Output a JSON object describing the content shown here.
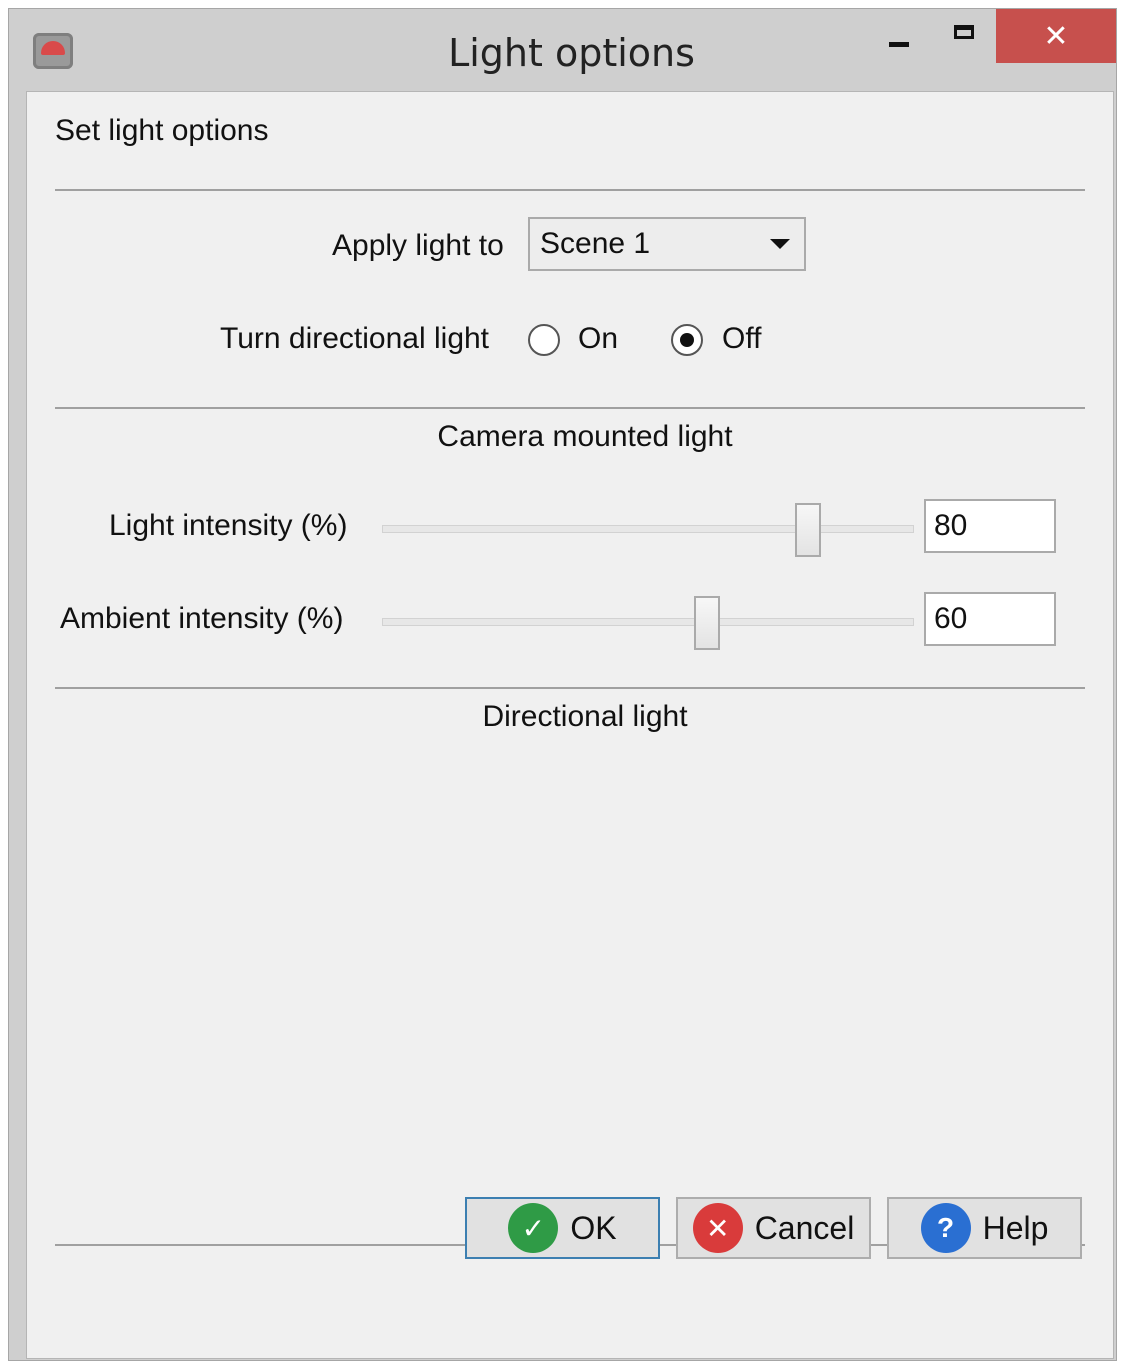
{
  "window": {
    "title": "Light options",
    "icon": "app-icon",
    "controls": {
      "minimize": "minimize-icon",
      "maximize": "maximize-icon",
      "close": "close-icon",
      "close_glyph": "✕"
    }
  },
  "header": {
    "description": "Set light options"
  },
  "apply": {
    "label": "Apply light to",
    "selected": "Scene 1"
  },
  "directional_toggle": {
    "label": "Turn directional light",
    "options": [
      {
        "label": "On",
        "checked": false
      },
      {
        "label": "Off",
        "checked": true
      }
    ]
  },
  "camera_section": {
    "title": "Camera mounted light",
    "light_intensity": {
      "label": "Light intensity (%)",
      "value": "80",
      "slider_fraction": 0.8
    },
    "ambient_intensity": {
      "label": "Ambient intensity (%)",
      "value": "60",
      "slider_fraction": 0.61
    }
  },
  "directional_section": {
    "title": "Directional light"
  },
  "buttons": {
    "ok": {
      "label": "OK",
      "icon": "check-icon",
      "glyph": "✓"
    },
    "cancel": {
      "label": "Cancel",
      "icon": "x-circle-icon",
      "glyph": "✕"
    },
    "help": {
      "label": "Help",
      "icon": "question-icon",
      "glyph": "?"
    }
  },
  "colors": {
    "close_button": "#c7504d",
    "ok_icon": "#2f9b46",
    "cancel_icon": "#d93b3b",
    "help_icon": "#2a6fd2",
    "default_border": "#3c7fb1"
  }
}
